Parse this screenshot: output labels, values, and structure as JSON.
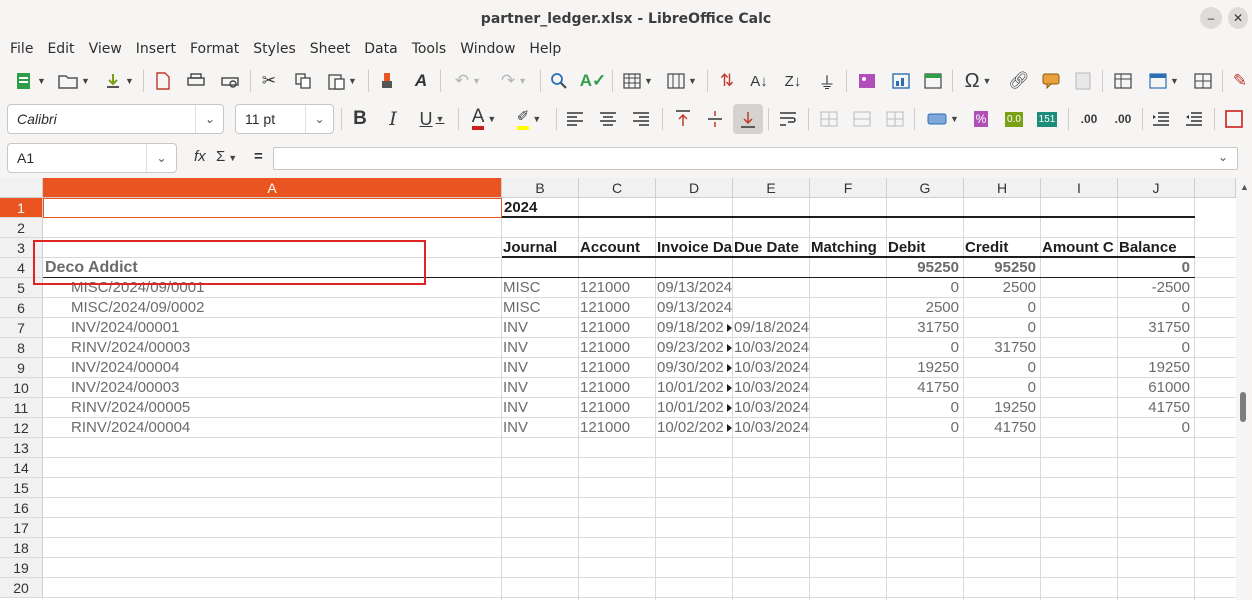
{
  "window": {
    "title": "partner_ledger.xlsx - LibreOffice Calc",
    "minimize_glyph": "–",
    "close_glyph": "✕"
  },
  "menu": [
    "File",
    "Edit",
    "View",
    "Insert",
    "Format",
    "Styles",
    "Sheet",
    "Data",
    "Tools",
    "Window",
    "Help"
  ],
  "format_toolbar": {
    "font_name": "Calibri",
    "font_size": "11 pt"
  },
  "formula_bar": {
    "cell_reference": "A1",
    "function_wizard": "fx",
    "sum_symbol": "Σ",
    "equals_symbol": "=",
    "formula_value": ""
  },
  "sheet": {
    "active_cell": "A1",
    "columns": [
      "A",
      "B",
      "C",
      "D",
      "E",
      "F",
      "G",
      "H",
      "I",
      "J"
    ],
    "rows": [
      "1",
      "2",
      "3",
      "4",
      "5",
      "6",
      "7",
      "8",
      "9",
      "10",
      "11",
      "12",
      "13",
      "14",
      "15",
      "16",
      "17",
      "18",
      "19",
      "20"
    ],
    "year": "2024",
    "headers": [
      "Journal",
      "Account",
      "Invoice Da",
      "Due Date",
      "Matching",
      "Debit",
      "Credit",
      "Amount C",
      "Balance"
    ],
    "partner": {
      "name": "Deco Addict",
      "debit": "95250",
      "credit": "95250",
      "balance": "0"
    },
    "entries": [
      {
        "ref": "MISC/2024/09/0001",
        "journal": "MISC",
        "account": "121000",
        "invoice_date": "09/13/2024",
        "due_date": "",
        "debit": "0",
        "credit": "2500",
        "balance": "-2500"
      },
      {
        "ref": "MISC/2024/09/0002",
        "journal": "MISC",
        "account": "121000",
        "invoice_date": "09/13/2024",
        "due_date": "",
        "debit": "2500",
        "credit": "0",
        "balance": "0"
      },
      {
        "ref": "INV/2024/00001",
        "journal": "INV",
        "account": "121000",
        "invoice_date": "09/18/202",
        "due_date": "09/18/2024",
        "debit": "31750",
        "credit": "0",
        "balance": "31750"
      },
      {
        "ref": "RINV/2024/00003",
        "journal": "INV",
        "account": "121000",
        "invoice_date": "09/23/202",
        "due_date": "10/03/2024",
        "debit": "0",
        "credit": "31750",
        "balance": "0"
      },
      {
        "ref": "INV/2024/00004",
        "journal": "INV",
        "account": "121000",
        "invoice_date": "09/30/202",
        "due_date": "10/03/2024",
        "debit": "19250",
        "credit": "0",
        "balance": "19250"
      },
      {
        "ref": "INV/2024/00003",
        "journal": "INV",
        "account": "121000",
        "invoice_date": "10/01/202",
        "due_date": "10/03/2024",
        "debit": "41750",
        "credit": "0",
        "balance": "61000"
      },
      {
        "ref": "RINV/2024/00005",
        "journal": "INV",
        "account": "121000",
        "invoice_date": "10/01/202",
        "due_date": "10/03/2024",
        "debit": "0",
        "credit": "19250",
        "balance": "41750"
      },
      {
        "ref": "RINV/2024/00004",
        "journal": "INV",
        "account": "121000",
        "invoice_date": "10/02/202",
        "due_date": "10/03/2024",
        "debit": "0",
        "credit": "41750",
        "balance": "0"
      }
    ]
  },
  "colors": {
    "accent": "#e95420",
    "annotation": "#e02424"
  }
}
